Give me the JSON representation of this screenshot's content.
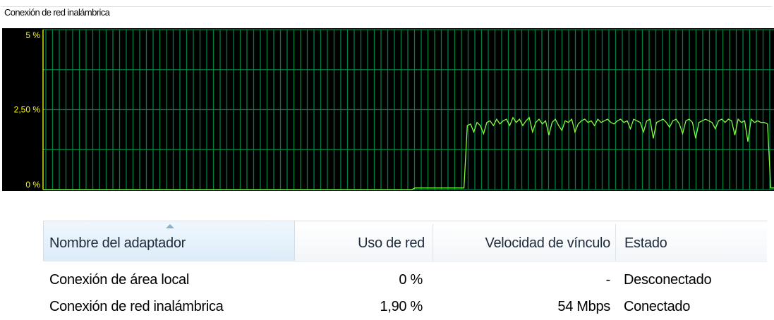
{
  "group": {
    "title": "Conexión de red inalámbrica"
  },
  "chart_data": {
    "type": "line",
    "ylim": [
      0,
      5
    ],
    "y_ticks": [
      "5 %",
      "2,50 %",
      "0 %"
    ],
    "grid": true,
    "series": [
      {
        "values": [
          0,
          0,
          0,
          0,
          0,
          0,
          0,
          0,
          0,
          0,
          0,
          0,
          0,
          0,
          0,
          0,
          0,
          0,
          0,
          0,
          0,
          0,
          0,
          0,
          0,
          0,
          0,
          0,
          0,
          0,
          0,
          0,
          0,
          0,
          0,
          0,
          0,
          0,
          0,
          0,
          0,
          0,
          0,
          0,
          0,
          0,
          0,
          0,
          0,
          0,
          0,
          0,
          0,
          0,
          0,
          0,
          0,
          0,
          0,
          0,
          0,
          0,
          0,
          0,
          0,
          0,
          0,
          0,
          0,
          0,
          0,
          0,
          0,
          0,
          0,
          0,
          0,
          0,
          0,
          0,
          0,
          0,
          0,
          0,
          0,
          0,
          0,
          0,
          0,
          0,
          0,
          0,
          0,
          0,
          0,
          0,
          0,
          0,
          0,
          0,
          0,
          0,
          0,
          0,
          0,
          0,
          0,
          0,
          0,
          0,
          0,
          0,
          0,
          0,
          0.05,
          0.05,
          0.05,
          0.05,
          0.05,
          0.05,
          0.05,
          0.05,
          0.05,
          0.05,
          0.05,
          0.05,
          0.05,
          0.05,
          0.05,
          0.05,
          2.0,
          2.05,
          1.8,
          2.1,
          2.0,
          1.75,
          2.1,
          2.15,
          2.0,
          2.2,
          2.05,
          2.15,
          2.2,
          2.0,
          2.25,
          2.1,
          2.2,
          2.0,
          2.15,
          2.25,
          1.8,
          2.1,
          2.2,
          2.05,
          2.15,
          1.7,
          2.1,
          2.2,
          2.0,
          1.85,
          2.15,
          2.1,
          2.2,
          1.8,
          2.05,
          2.15,
          2.2,
          2.1,
          2.15,
          2.0,
          2.2,
          2.1,
          2.15,
          2.2,
          2.1,
          2.05,
          2.15,
          2.2,
          2.1,
          2.15,
          1.9,
          2.2,
          2.15,
          2.1,
          1.8,
          2.15,
          2.2,
          1.6,
          2.1,
          2.15,
          2.2,
          2.1,
          1.95,
          2.15,
          2.2,
          2.05,
          1.75,
          2.15,
          2.2,
          2.1,
          1.6,
          2.1,
          2.15,
          2.2,
          2.15,
          2.1,
          1.9,
          2.15,
          2.2,
          2.1,
          2.2,
          2.15,
          1.7,
          2.2,
          2.1,
          2.15,
          1.5,
          2.2,
          2.1,
          2.15,
          2.1,
          2.1,
          2.05,
          0.05,
          0.05
        ]
      }
    ]
  },
  "table": {
    "columns": [
      {
        "label": "Nombre del adaptador",
        "sorted": true
      },
      {
        "label": "Uso de red"
      },
      {
        "label": "Velocidad de vínculo"
      },
      {
        "label": "Estado"
      }
    ],
    "rows": [
      [
        "Conexión de área local",
        "0 %",
        "-",
        "Desconectado"
      ],
      [
        "Conexión de red inalámbrica",
        "1,90 %",
        "54 Mbps",
        "Conectado"
      ]
    ]
  },
  "colors": {
    "chart_background": "#000000",
    "grid": "#008040",
    "line": "#80ff40",
    "axis_labels": "#ffff00"
  }
}
